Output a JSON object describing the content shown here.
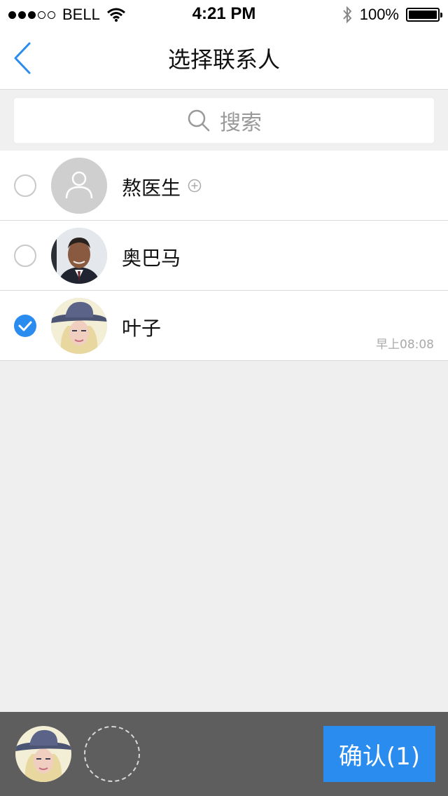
{
  "status_bar": {
    "carrier": "BELL",
    "time": "4:21 PM",
    "battery": "100%",
    "signal_icon": "signal-dots-icon",
    "wifi_icon": "wifi-icon",
    "bluetooth_icon": "bluetooth-icon",
    "battery_icon": "battery-icon"
  },
  "nav": {
    "title": "选择联系人",
    "back_icon": "chevron-left-icon"
  },
  "search": {
    "label": "搜索",
    "icon": "search-icon"
  },
  "contacts": [
    {
      "name": "熬医生",
      "selected": false,
      "avatar": "default-person-icon",
      "has_add": true,
      "time": ""
    },
    {
      "name": "奥巴马",
      "selected": false,
      "avatar": "photo-man",
      "has_add": false,
      "time": ""
    },
    {
      "name": "叶子",
      "selected": true,
      "avatar": "photo-woman-hat",
      "has_add": false,
      "time": "早上08:08"
    }
  ],
  "bottom": {
    "confirm_label": "确认(1)",
    "selected_count": 1
  },
  "colors": {
    "accent": "#2b8cf0",
    "bottom_bar": "#5e5e5e",
    "background": "#efefef"
  }
}
